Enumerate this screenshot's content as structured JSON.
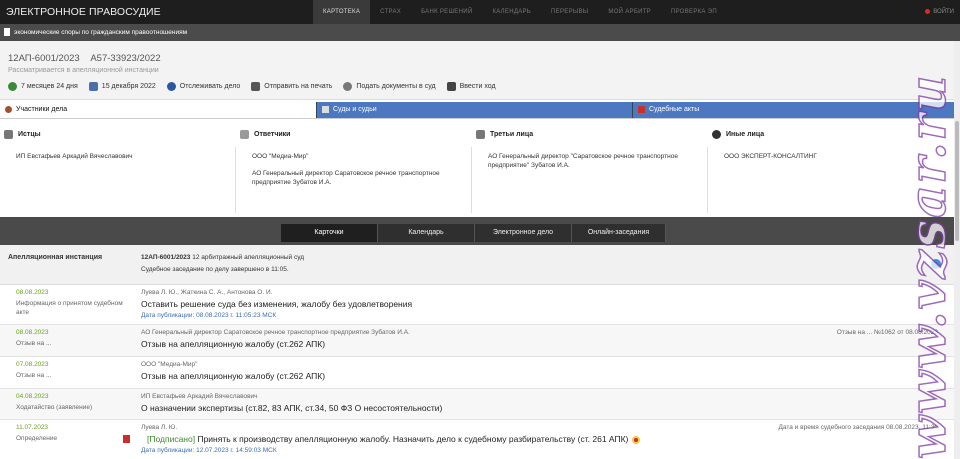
{
  "topbar": {
    "brand": "ЭЛЕКТРОННОЕ ПРАВОСУДИЕ",
    "nav": [
      "КАРТОТЕКА",
      "СТРАХ",
      "БАНК РЕШЕНИЙ",
      "КАЛЕНДАРЬ",
      "ПЕРЕРЫВЫ",
      "МОЙ АРБИТР",
      "ПРОВЕРКА ЭП"
    ],
    "active_nav": "КАРТОТЕКА",
    "login": "ВОЙТИ"
  },
  "category": "экономические споры по гражданским правоотношениям",
  "header": {
    "case_no": "12АП-6001/2023",
    "first_no": "А57-33923/2022",
    "status": "Рассматривается в апелляционной инстанции",
    "actions": [
      "7 месяцев 24 дня",
      "15 декабря 2022",
      "Отслеживать дело",
      "Отправить на печать",
      "Подать документы в суд",
      "Ввести ход"
    ]
  },
  "tabs": [
    "Участники дела",
    "Суды и судьи",
    "Судебные акты"
  ],
  "parties": [
    {
      "title": "Истцы",
      "icon": "scales-icon",
      "items": [
        "ИП Евстафьев Аркадий Вячеславович"
      ]
    },
    {
      "title": "Ответчики",
      "icon": "shield-icon",
      "items": [
        "ООО \"Медиа-Мир\"",
        "АО Генеральный директор Саратовское речное транспортное предприятие Зубатов И.А."
      ]
    },
    {
      "title": "Третьи лица",
      "icon": "building-icon",
      "items": [
        "АО Генеральный директор \"Саратовское речное транспортное предприятие\" Зубатов И.А."
      ]
    },
    {
      "title": "Иные лица",
      "icon": "person-icon",
      "items": [
        "ООО ЭКСПЕРТ-КОНСАЛТИНГ"
      ]
    }
  ],
  "midtabs": [
    "Карточки",
    "Календарь",
    "Электронное дело",
    "Онлайн-заседания"
  ],
  "instance": {
    "label": "Апелляционная инстанция",
    "case": "12АП-6001/2023",
    "court": " 12 арбитражный апелляционный суд",
    "result": "Судебное заседание по делу завершено в 11:05."
  },
  "events": [
    {
      "date": "08.08.2023",
      "type": "Информация о принятом судебном акте",
      "who": "Луева Л. Ю., Жаткина С. А., Антонова О. И.",
      "title": "Оставить решение суда без изменения, жалобу без удовлетворения",
      "pub": "Дата публикации: 08.08.2023 г. 11:05:23 МСК",
      "right": ""
    },
    {
      "date": "08.08.2023",
      "type": "Отзыв на ...",
      "who": "АО Генеральный директор Саратовское речное транспортное предприятие Зубатов И.А.",
      "title": "Отзыв на апелляционную жалобу (ст.262 АПК)",
      "pub": "",
      "right": "Отзыв на ... №1062 от 08.08.2023"
    },
    {
      "date": "07.08.2023",
      "type": "Отзыв на ...",
      "who": "ООО \"Медиа-Мир\"",
      "title": "Отзыв на апелляционную жалобу (ст.262 АПК)",
      "pub": "",
      "right": ""
    },
    {
      "date": "04.08.2023",
      "type": "Ходатайство (заявление)",
      "who": "ИП Евстафьев Аркадий Вячеславович",
      "title": "О назначении экспертизы (ст.82, 83 АПК, ст.34, 50 ФЗ О несостоятельности)",
      "pub": "",
      "right": ""
    },
    {
      "date": "11.07.2023",
      "type": "Определение",
      "who": "Луева Л. Ю.",
      "signed": "[Подписано]",
      "title": " Принять к производству апелляционную жалобу. Назначить дело к судебному разбирательству (ст. 261 АПК)",
      "pub": "Дата публикации: 12.07.2023 г. 14:59:03 МСК",
      "right": "Дата и время судебного заседания 08.08.2023, 11:30"
    }
  ],
  "watermark": "www.vzsar.ru"
}
